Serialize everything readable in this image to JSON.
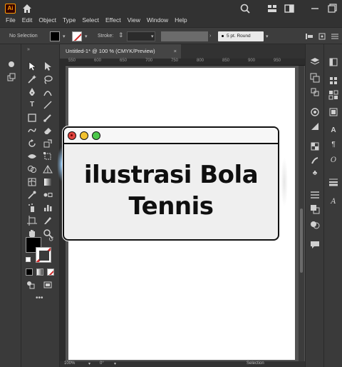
{
  "app": {
    "logo_text": "Ai",
    "menus": [
      "File",
      "Edit",
      "Object",
      "Type",
      "Select",
      "Effect",
      "View",
      "Window",
      "Help"
    ]
  },
  "control": {
    "selection_label": "No Selection",
    "stroke_label": "Stroke:",
    "brush_label": "5 pt. Round"
  },
  "document": {
    "tab_title": "Untitled-1* @ 100 % (CMYK/Preview)",
    "close_glyph": "×",
    "ruler_ticks": [
      "550",
      "600",
      "650",
      "700",
      "750",
      "800",
      "850",
      "900",
      "950"
    ]
  },
  "status": {
    "zoom": "100%",
    "rotation": "0°",
    "tool": "Selection"
  },
  "card": {
    "title": "ilustrasi Bola Tennis",
    "colors": {
      "red": "#e0443e",
      "yellow": "#f2c230",
      "green": "#4cc84a"
    }
  },
  "colors": {
    "accent": "#ff9a00",
    "menubar": "#323232",
    "panel": "#3a3a3a"
  }
}
